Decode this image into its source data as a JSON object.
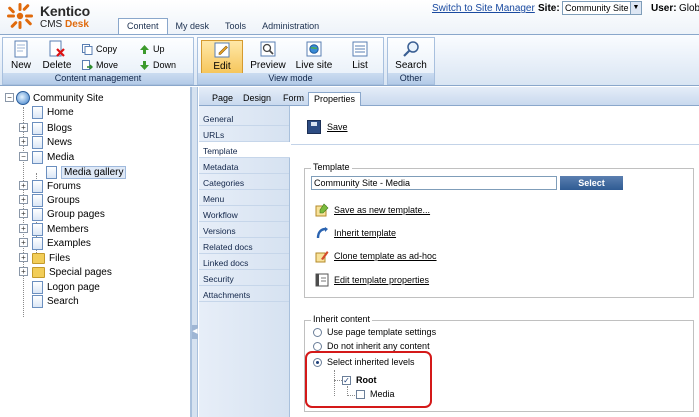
{
  "brand": {
    "name": "Kentico",
    "product_pre": "CMS",
    "product_post": "Desk"
  },
  "main_tabs": [
    {
      "label": "Content",
      "active": true
    },
    {
      "label": "My desk",
      "active": false
    },
    {
      "label": "Tools",
      "active": false
    },
    {
      "label": "Administration",
      "active": false
    }
  ],
  "header": {
    "switch_link": "Switch to Site Manager",
    "site_label": "Site:",
    "site_value": "Community Site",
    "user_label": "User:",
    "user_value": "Glob"
  },
  "toolbar": {
    "content_management": {
      "label": "Content management",
      "new": "New",
      "delete": "Delete",
      "copy": "Copy",
      "move": "Move",
      "up": "Up",
      "down": "Down"
    },
    "view_mode": {
      "label": "View mode",
      "edit": "Edit",
      "preview": "Preview",
      "live_site": "Live site",
      "list": "List"
    },
    "other": {
      "label": "Other",
      "search": "Search"
    }
  },
  "tree": {
    "root": "Community Site",
    "items": [
      {
        "label": "Home"
      },
      {
        "label": "Blogs"
      },
      {
        "label": "News"
      },
      {
        "label": "Media"
      },
      {
        "label": "Media gallery"
      },
      {
        "label": "Forums"
      },
      {
        "label": "Groups"
      },
      {
        "label": "Group pages"
      },
      {
        "label": "Members"
      },
      {
        "label": "Examples"
      },
      {
        "label": "Files"
      },
      {
        "label": "Special pages"
      },
      {
        "label": "Logon page"
      },
      {
        "label": "Search"
      }
    ]
  },
  "sub_tabs": [
    {
      "label": "Page",
      "active": false
    },
    {
      "label": "Design",
      "active": false
    },
    {
      "label": "Form",
      "active": false
    },
    {
      "label": "Properties",
      "active": true
    }
  ],
  "properties_menu": [
    {
      "label": "General",
      "active": false
    },
    {
      "label": "URLs",
      "active": false
    },
    {
      "label": "Template",
      "active": true
    },
    {
      "label": "Metadata",
      "active": false
    },
    {
      "label": "Categories",
      "active": false
    },
    {
      "label": "Menu",
      "active": false
    },
    {
      "label": "Workflow",
      "active": false
    },
    {
      "label": "Versions",
      "active": false
    },
    {
      "label": "Related docs",
      "active": false
    },
    {
      "label": "Linked docs",
      "active": false
    },
    {
      "label": "Security",
      "active": false
    },
    {
      "label": "Attachments",
      "active": false
    }
  ],
  "content": {
    "save_label": "Save",
    "template": {
      "legend": "Template",
      "value": "Community Site - Media",
      "select_button": "Select",
      "actions": [
        {
          "label": "Save as new template..."
        },
        {
          "label": "Inherit template"
        },
        {
          "label": "Clone template as ad-hoc"
        },
        {
          "label": "Edit template properties"
        }
      ]
    },
    "inherit": {
      "legend": "Inherit content",
      "options": [
        {
          "label": "Use page template settings",
          "selected": false
        },
        {
          "label": "Do not inherit any content",
          "selected": false
        },
        {
          "label": "Select inherited levels",
          "selected": true
        }
      ],
      "levels": [
        {
          "label": "Root",
          "checked": true
        },
        {
          "label": "Media",
          "checked": false
        }
      ]
    }
  },
  "colors": {
    "accent": "#e06a0c",
    "link": "#1a4aa0",
    "highlight_border": "#d41919",
    "active_button": "#f6c65c"
  }
}
